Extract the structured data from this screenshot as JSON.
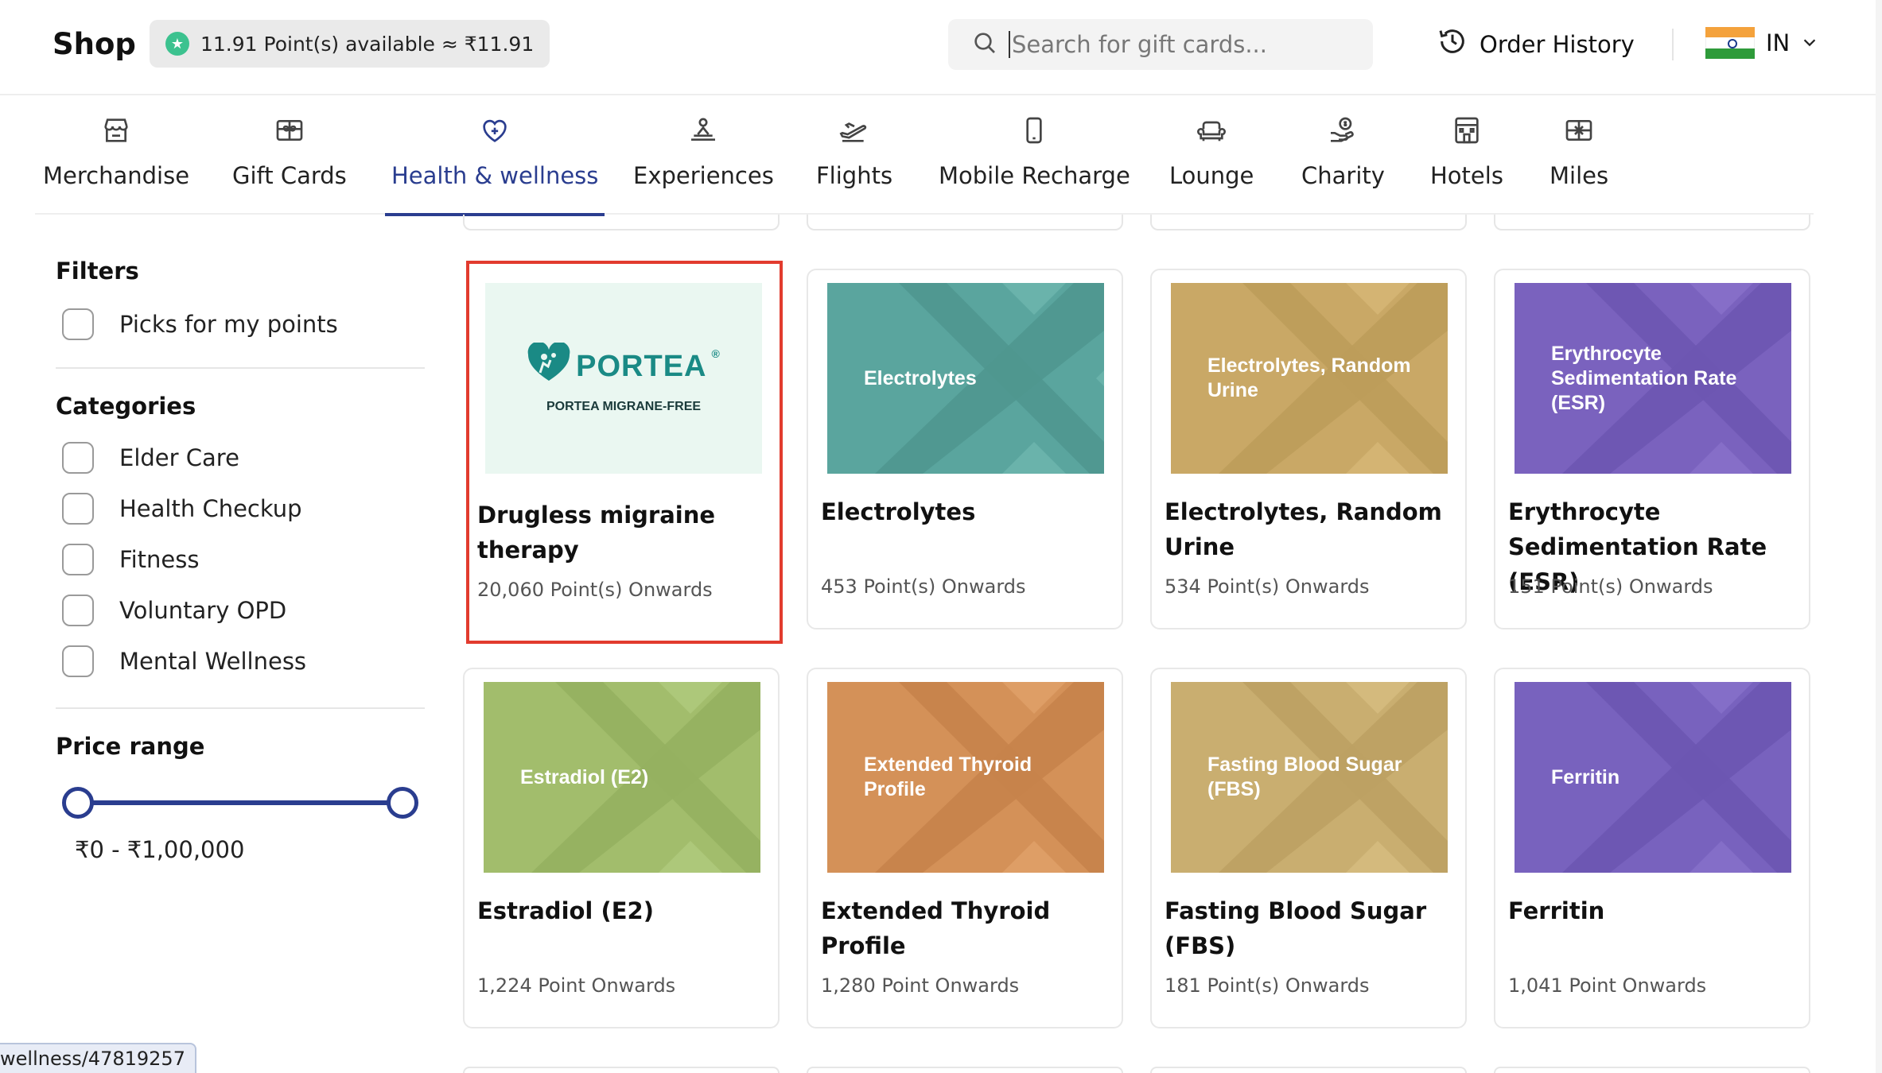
{
  "header": {
    "shop_title": "Shop",
    "points_text": "11.91 Point(s) available ≈ ₹11.91",
    "search_placeholder": "Search for gift cards...",
    "order_history": "Order History",
    "country_code": "IN"
  },
  "categories": [
    {
      "label": "Merchandise",
      "icon": "store-icon"
    },
    {
      "label": "Gift Cards",
      "icon": "gift-card-icon"
    },
    {
      "label": "Health & wellness",
      "icon": "heart-plus-icon",
      "active": true
    },
    {
      "label": "Experiences",
      "icon": "experience-icon"
    },
    {
      "label": "Flights",
      "icon": "plane-icon"
    },
    {
      "label": "Mobile Recharge",
      "icon": "mobile-icon"
    },
    {
      "label": "Lounge",
      "icon": "sofa-icon"
    },
    {
      "label": "Charity",
      "icon": "charity-icon"
    },
    {
      "label": "Hotels",
      "icon": "hotel-icon"
    },
    {
      "label": "Miles",
      "icon": "miles-icon"
    }
  ],
  "sidebar": {
    "filters_title": "Filters",
    "picks_label": "Picks for my points",
    "categories_title": "Categories",
    "category_items": [
      "Elder Care",
      "Health Checkup",
      "Fitness",
      "Voluntary OPD",
      "Mental Wellness"
    ],
    "price_title": "Price range",
    "price_text": "₹0 - ₹1,00,000"
  },
  "products": [
    {
      "name": "Drugless migraine therapy",
      "points": "20,060 Point(s) Onwards",
      "brand": "PORTEA",
      "brand_sub": "PORTEA MIGRANE-FREE",
      "selected": true
    },
    {
      "name": "Electrolytes",
      "points": "453 Point(s) Onwards",
      "thumb_text": "Electrolytes",
      "color": "#5aa59e"
    },
    {
      "name": "Electrolytes, Random Urine",
      "points": "534 Point(s) Onwards",
      "thumb_text": "Electrolytes, Random Urine",
      "color": "#c9a866"
    },
    {
      "name": "Erythrocyte Sedimentation Rate (ESR)",
      "points": "151 Point(s) Onwards",
      "thumb_text": "Erythrocyte Sedimentation Rate (ESR)",
      "color": "#7a62be"
    },
    {
      "name": "Estradiol (E2)",
      "points": "1,224 Point Onwards",
      "thumb_text": "Estradiol (E2)",
      "color": "#a2bd6c"
    },
    {
      "name": "Extended Thyroid Profile",
      "points": "1,280 Point Onwards",
      "thumb_text": "Extended Thyroid Profile",
      "color": "#d49158"
    },
    {
      "name": "Fasting Blood Sugar (FBS)",
      "points": "181 Point(s) Onwards",
      "thumb_text": "Fasting Blood Sugar (FBS)",
      "color": "#c9ae70"
    },
    {
      "name": "Ferritin",
      "points": "1,041 Point Onwards",
      "thumb_text": "Ferritin",
      "color": "#7862be"
    }
  ],
  "statusbar": {
    "url_text": "wellness/47819257"
  }
}
